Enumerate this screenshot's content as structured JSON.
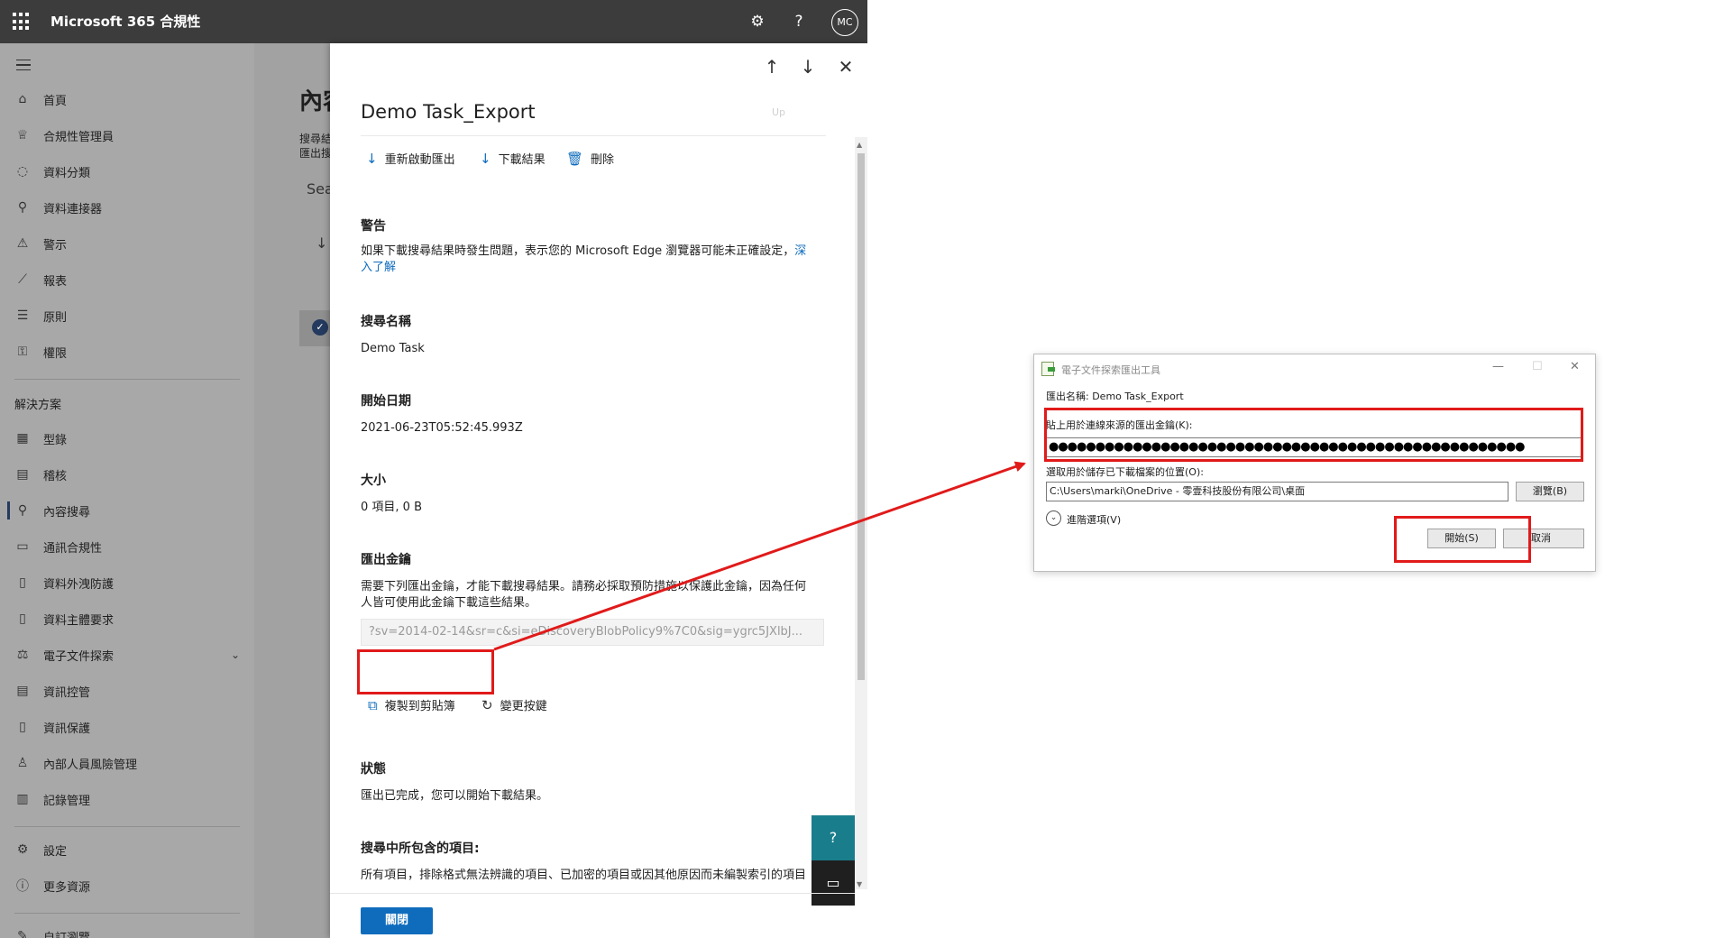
{
  "header": {
    "app_title": "Microsoft 365 合規性",
    "avatar_initials": "MC"
  },
  "sidebar": {
    "items": [
      {
        "label": "首頁",
        "icon": "home-icon"
      },
      {
        "label": "合規性管理員",
        "icon": "trophy-icon"
      },
      {
        "label": "資料分類",
        "icon": "classification-icon"
      },
      {
        "label": "資料連接器",
        "icon": "connector-icon"
      },
      {
        "label": "警示",
        "icon": "alert-icon"
      },
      {
        "label": "報表",
        "icon": "chart-icon"
      },
      {
        "label": "原則",
        "icon": "policy-icon"
      },
      {
        "label": "權限",
        "icon": "key-icon"
      }
    ],
    "solutions_heading": "解決方案",
    "solutions": [
      {
        "label": "型錄",
        "icon": "catalog-icon"
      },
      {
        "label": "稽核",
        "icon": "audit-icon"
      },
      {
        "label": "內容搜尋",
        "icon": "search-icon"
      },
      {
        "label": "通訊合規性",
        "icon": "communication-icon"
      },
      {
        "label": "資料外洩防護",
        "icon": "dlp-icon"
      },
      {
        "label": "資料主體要求",
        "icon": "subject-request-icon"
      },
      {
        "label": "電子文件探索",
        "icon": "ediscovery-icon"
      },
      {
        "label": "資訊控管",
        "icon": "governance-icon"
      },
      {
        "label": "資訊保護",
        "icon": "protection-icon"
      },
      {
        "label": "內部人員風險管理",
        "icon": "insider-risk-icon"
      },
      {
        "label": "記錄管理",
        "icon": "records-icon"
      }
    ],
    "footer": [
      {
        "label": "設定",
        "icon": "gear-icon"
      },
      {
        "label": "更多資源",
        "icon": "info-icon"
      },
      {
        "label": "自訂瀏覽",
        "icon": "edit-icon"
      }
    ]
  },
  "background_page": {
    "heading": "內容",
    "sub_line1": "搜尋結",
    "sub_line2": "匯出搜",
    "search_text": "Sea"
  },
  "panel": {
    "title": "Demo Task_Export",
    "ghost_label": "Up",
    "commands": {
      "restart": "重新啟動匯出",
      "download": "下載結果",
      "delete": "刪除"
    },
    "warning": {
      "title": "警告",
      "text": "如果下載搜尋結果時發生問題，表示您的 Microsoft Edge 瀏覽器可能未正確設定，",
      "link": "深入了解"
    },
    "search_name": {
      "title": "搜尋名稱",
      "value": "Demo Task"
    },
    "start_date": {
      "title": "開始日期",
      "value": "2021-06-23T05:52:45.993Z"
    },
    "size": {
      "title": "大小",
      "value": "0 項目, 0 B"
    },
    "export_key": {
      "title": "匯出金鑰",
      "text": "需要下列匯出金鑰，才能下載搜尋結果。請務必採取預防措施以保護此金鑰，因為任何人皆可使用此金鑰下載這些結果。",
      "value": "?sv=2014-02-14&sr=c&si=eDiscoveryBlobPolicy9%7C0&sig=ygrc5JXlbJ...",
      "copy_label": "複製到剪貼簿",
      "change_label": "變更按鍵"
    },
    "status": {
      "title": "狀態",
      "value": "匯出已完成，您可以開始下載結果。"
    },
    "included": {
      "title": "搜尋中所包含的項目:",
      "text": "所有項目，排除格式無法辨識的項目、已加密的項目或因其他原因而未編製索引的項目"
    },
    "close_label": "關閉"
  },
  "export_tool": {
    "title": "電子文件探索匯出工具",
    "export_name_label": "匯出名稱: Demo Task_Export",
    "key_label": "貼上用於連線來源的匯出金鑰(K):",
    "key_masked": "●●●●●●●●●●●●●●●●●●●●●●●●●●●●●●●●●●●●●●●●●●●●●●●●●●●",
    "location_label": "選取用於儲存已下載檔案的位置(O):",
    "location_value": "C:\\Users\\marki\\OneDrive - 零壹科技股份有限公司\\桌面",
    "browse_label": "瀏覽(B)",
    "advanced_label": "進階選項(V)",
    "start_label": "開始(S)",
    "cancel_label": "取消"
  },
  "colors": {
    "accent": "#0f6cbd",
    "topbar": "#3c3c3c",
    "highlight": "#e11a1a",
    "help_button": "#1a7d8c"
  }
}
